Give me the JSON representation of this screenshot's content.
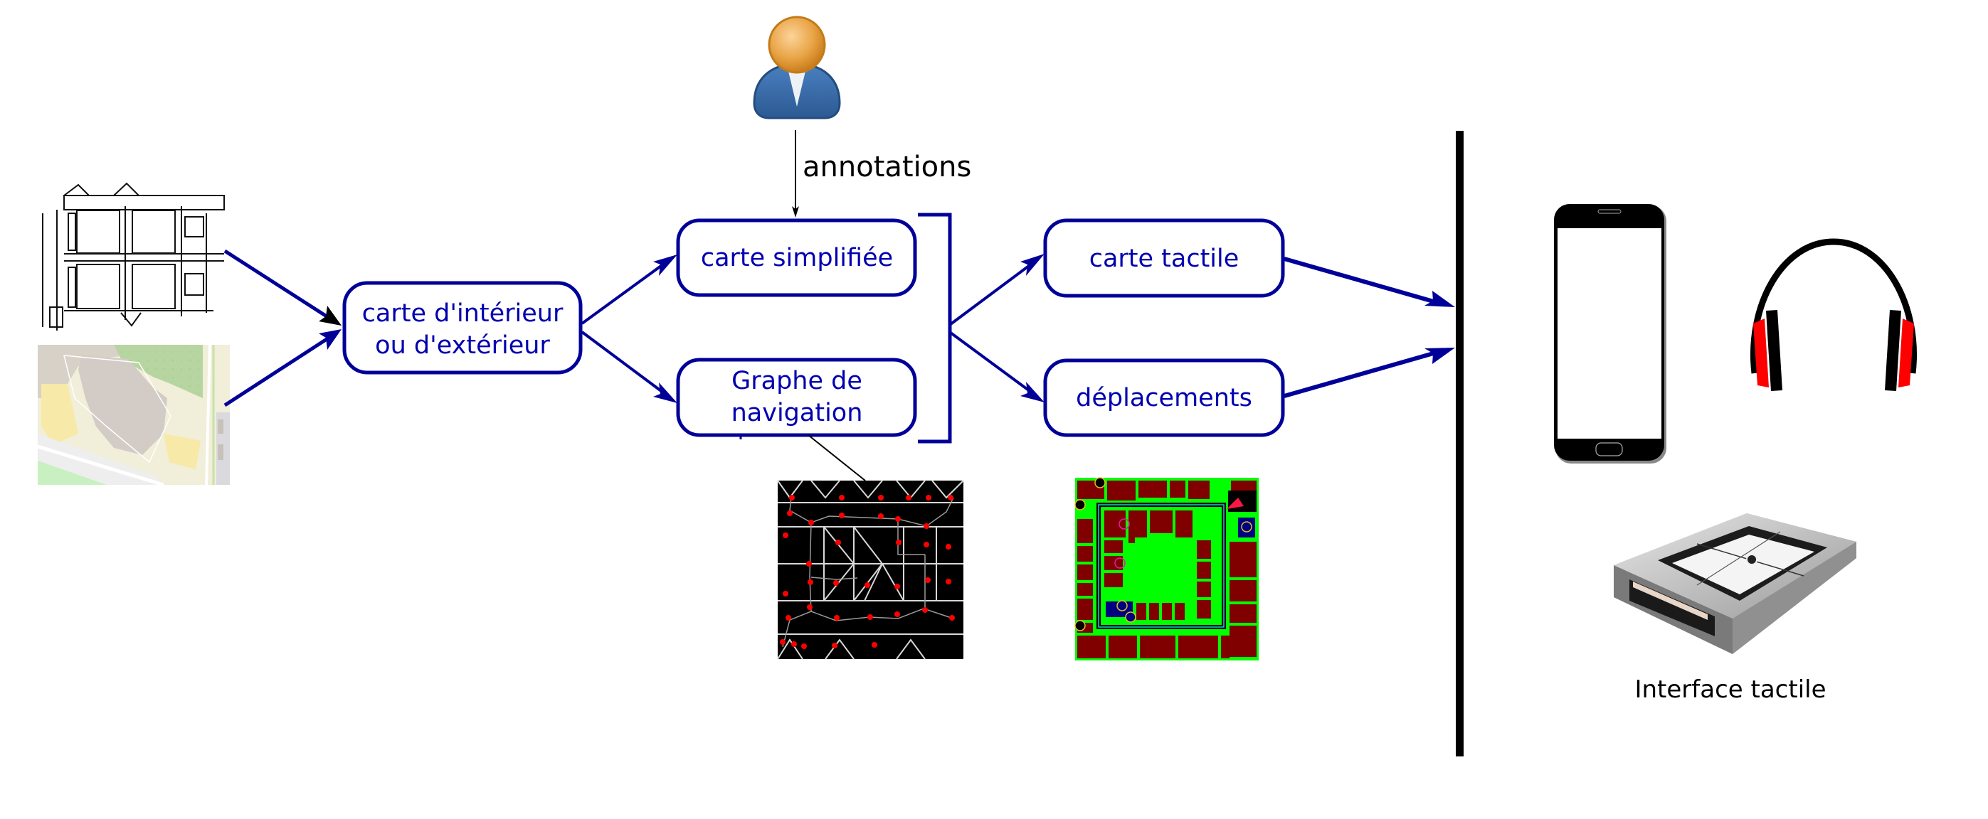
{
  "colors": {
    "flow_blue": "#000099",
    "text_blue": "#0000b0",
    "separator": "#000000",
    "graph_node_red": "#ff0000",
    "tactile_wall_green": "#00ff00",
    "tactile_room_red": "#800000",
    "headphone_red": "#ff0000",
    "person_head": "#e8a33a",
    "person_body": "#3a6ea8"
  },
  "inputs": {
    "floor_plan": {
      "icon": "floor-plan-image",
      "alt": "plan d'intérieur"
    },
    "street_map": {
      "icon": "street-map-image",
      "alt": "carte d'extérieur"
    }
  },
  "nodes": {
    "source_map": {
      "line1": "carte d'intérieur",
      "line2": "ou d'extérieur"
    },
    "simplified_map": {
      "label": "carte simplifiée"
    },
    "nav_graph": {
      "line1": "Graphe de",
      "line2": "navigation"
    },
    "tactile_map": {
      "label": "carte tactile"
    },
    "movements": {
      "label": "déplacements"
    }
  },
  "user": {
    "icon": "user-icon",
    "edge_label": "annotations"
  },
  "examples": {
    "graph_image": {
      "icon": "navigation-graph-image"
    },
    "tactile_image": {
      "icon": "tactile-map-image"
    }
  },
  "outputs": {
    "phone": {
      "icon": "smartphone-icon"
    },
    "headphones": {
      "icon": "headphones-icon"
    },
    "tactile_device": {
      "icon": "tactile-interface-icon",
      "caption": "Interface tactile"
    }
  }
}
